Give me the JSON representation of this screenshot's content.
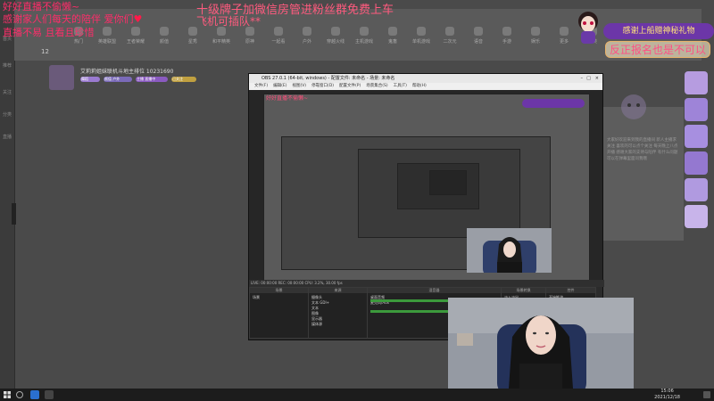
{
  "overlay": {
    "line1": "好好直播不偷懒~",
    "line2": "感谢家人们每天的陪伴 爱你们",
    "line3": "直播不易 且看且珍惜",
    "center1": "十级牌子加微信房管进粉丝群免费上车",
    "center2": "飞机可插队**",
    "banner": "感谢上船赠神秘礼物",
    "badge": "反正报名也是不可以"
  },
  "browser": {
    "left_rail": [
      "首页",
      "推荐",
      "关注",
      "分类",
      "直播"
    ],
    "nav_count": "12",
    "nav_items": [
      "热门",
      "英雄联盟",
      "王者荣耀",
      "颜值",
      "星秀",
      "和平精英",
      "原神",
      "一起看",
      "户外",
      "穿越火线",
      "主机游戏",
      "鬼畜",
      "单机游戏",
      "二次元",
      "语音",
      "手游",
      "娱乐",
      "更多",
      "分类"
    ],
    "streamer_name": "艾莉莉姐妹联机斗地主排位 10231690",
    "streamer_meta": [
      "舞蹈",
      "颜值 户外",
      "主播 直播中",
      "已关注"
    ],
    "right_panel_text": "大家好欢迎来到我的直播间 新人主播求关注 喜欢的可以点个关注 每天晚上八点开播 感谢大家的支持与陪伴 有什么问题可以在弹幕里面问我哦"
  },
  "obs": {
    "title": "OBS 27.0.1 (64-bit, windows) - 配置文件: 未命名 - 场景: 未命名",
    "menu": [
      "文件(F)",
      "编辑(E)",
      "视图(V)",
      "停靠窗口(D)",
      "配置文件(P)",
      "场景集合(S)",
      "工具(T)",
      "帮助(H)"
    ],
    "docks": [
      {
        "header": "场景",
        "items": [
          "场景"
        ]
      },
      {
        "header": "来源",
        "items": [
          "摄像头",
          "文本 GDI+",
          "文本",
          "图像",
          "显示器",
          "媒体源"
        ]
      },
      {
        "header": "混音器",
        "items": [
          "桌面音频",
          "麦克风/Aux"
        ]
      },
      {
        "header": "场景转换",
        "items": [
          "淡入淡出",
          "时长 300 ms"
        ]
      },
      {
        "header": "控件",
        "items": [
          "开始推流",
          "开始录制",
          "工作室模式",
          "设置",
          "退出"
        ]
      }
    ],
    "status_bar": "LIVE: 00:00:00  REC: 00:00:00  CPU: 3.2%, 30.00 fps",
    "preview_overlay_title": "好好直播不偷懒~"
  },
  "taskbar": {
    "time": "15:06",
    "date": "2021/12/18"
  },
  "colors": {
    "overlay_pink": "#ff2d6a",
    "banner_purple": "#6c36a8",
    "sidebar_lilac": "#b69ce0",
    "obs_dark": "#262626"
  }
}
